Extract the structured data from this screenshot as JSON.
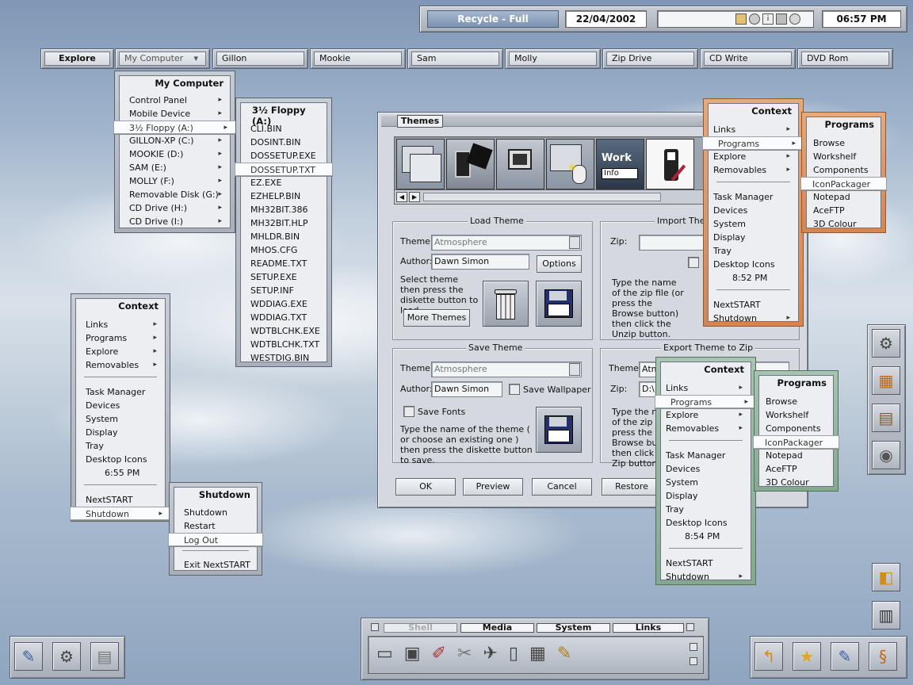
{
  "topbar": {
    "recycle": "Recycle - Full",
    "date": "22/04/2002",
    "time": "06:57 PM",
    "tray_icons": [
      "window-icon",
      "volume-icon",
      "info-icon",
      "network-icon",
      "globe-icon"
    ]
  },
  "nav": {
    "explore": "Explore",
    "my_computer": "My Computer",
    "drives": [
      "Gillon",
      "Mookie",
      "Sam",
      "Molly",
      "Zip Drive",
      "CD Write",
      "DVD Rom"
    ]
  },
  "my_computer_menu": {
    "title": "My Computer",
    "items": [
      "Control Panel",
      "Mobile Device",
      "3½ Floppy (A:)",
      "GILLON-XP (C:)",
      "MOOKIE (D:)",
      "SAM (E:)",
      "MOLLY (F:)",
      "Removable Disk (G:)",
      "CD Drive (H:)",
      "CD Drive (I:)"
    ]
  },
  "floppy_menu": {
    "title": "3½ Floppy (A:)",
    "items": [
      "CLI.BIN",
      "DOSINT.BIN",
      "DOSSETUP.EXE",
      "DOSSETUP.TXT",
      "EZ.EXE",
      "EZHELP.BIN",
      "MH32BIT.386",
      "MH32BIT.HLP",
      "MHLDR.BIN",
      "MHOS.CFG",
      "README.TXT",
      "SETUP.EXE",
      "SETUP.INF",
      "WDDIAG.EXE",
      "WDDIAG.TXT",
      "WDTBLCHK.EXE",
      "WDTBLCHK.TXT",
      "WESTDIG.BIN"
    ]
  },
  "context_left": {
    "title": "Context",
    "items": [
      "Links",
      "Programs",
      "Explore",
      "Removables",
      "Task Manager",
      "Devices",
      "System",
      "Display",
      "Tray",
      "Desktop Icons",
      "6:55 PM",
      "NextSTART",
      "Shutdown"
    ]
  },
  "shutdown_menu": {
    "title": "Shutdown",
    "items": [
      "Shutdown",
      "Restart",
      "Log Out",
      "Exit NextSTART"
    ]
  },
  "context_orange": {
    "title": "Context",
    "items": [
      "Links",
      "Programs",
      "Explore",
      "Removables",
      "Task Manager",
      "Devices",
      "System",
      "Display",
      "Tray",
      "Desktop Icons",
      "8:52 PM",
      "NextSTART",
      "Shutdown"
    ]
  },
  "programs_orange": {
    "title": "Programs",
    "items": [
      "Browse",
      "Workshelf",
      "Components",
      "IconPackager",
      "Notepad",
      "AceFTP",
      "3D Colour"
    ]
  },
  "context_green": {
    "title": "Context",
    "items": [
      "Links",
      "Programs",
      "Explore",
      "Removables",
      "Task Manager",
      "Devices",
      "System",
      "Display",
      "Tray",
      "Desktop Icons",
      "8:54 PM",
      "NextSTART",
      "Shutdown"
    ]
  },
  "programs_green": {
    "title": "Programs",
    "items": [
      "Browse",
      "Workshelf",
      "Components",
      "IconPackager",
      "Notepad",
      "AceFTP",
      "3D Colour"
    ]
  },
  "themes": {
    "tab": "Themes",
    "preview_info": "Info",
    "preview_work": "Work",
    "load": {
      "title": "Load Theme",
      "theme_label": "Theme:",
      "theme_value": "Atmosphere",
      "author_label": "Author:",
      "author_value": "Dawn Simon",
      "options": "Options",
      "help": "Select theme then press the diskette button to load.",
      "more": "More Themes"
    },
    "import": {
      "title": "Import Theme",
      "zip_label": "Zip:",
      "help": "Type the name of the zip file (or press the Browse button) then click the Unzip button."
    },
    "save": {
      "title": "Save Theme",
      "theme_label": "Theme:",
      "theme_value": "Atmosphere",
      "author_label": "Author:",
      "author_value": "Dawn Simon",
      "save_wallpaper": "Save Wallpaper",
      "save_fonts": "Save Fonts",
      "help": "Type the name of the theme ( or choose an existing one ) then press the diskette button to save."
    },
    "export": {
      "title": "Export Theme to Zip",
      "theme_label": "Theme:",
      "theme_value": "Atm",
      "zip_label": "Zip:",
      "zip_value": "D:\\",
      "help": "Type the name of the zip file (or press the Browse button) then click on the Zip button."
    },
    "buttons": {
      "ok": "OK",
      "preview": "Preview",
      "cancel": "Cancel",
      "restore": "Restore"
    }
  },
  "shelf": {
    "tabs": [
      "Shell",
      "Media",
      "System",
      "Links"
    ]
  },
  "colors": {
    "orange": "#d38553",
    "green": "#84a890",
    "panel": "#d5d9df"
  }
}
